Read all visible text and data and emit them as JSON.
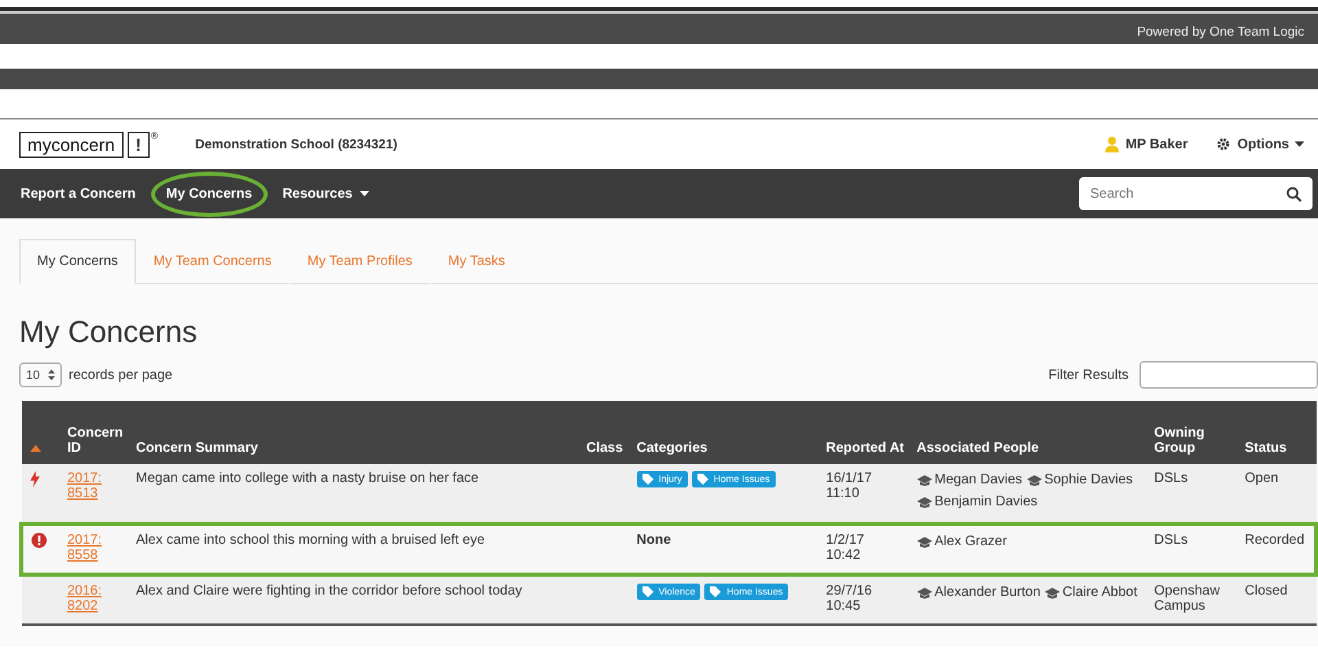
{
  "top_bar": {
    "powered_by": "Powered by One Team Logic"
  },
  "header": {
    "logo": "myconcern",
    "logo_mark": "!",
    "registered": "®",
    "school": "Demonstration School (8234321)",
    "user": "MP Baker",
    "options": "Options"
  },
  "nav": {
    "items": [
      {
        "label": "Report a Concern",
        "dropdown": false,
        "selected": false
      },
      {
        "label": "My Concerns",
        "dropdown": false,
        "selected": true
      },
      {
        "label": "Resources",
        "dropdown": true,
        "selected": false
      }
    ],
    "search": {
      "placeholder": "Search"
    }
  },
  "tabs": [
    {
      "label": "My Concerns",
      "selected": true
    },
    {
      "label": "My Team Concerns",
      "selected": false
    },
    {
      "label": "My Team Profiles",
      "selected": false
    },
    {
      "label": "My Tasks",
      "selected": false
    }
  ],
  "page_title": "My Concerns",
  "records": {
    "value": "10",
    "label": "records per page"
  },
  "filter": {
    "label": "Filter Results"
  },
  "table": {
    "columns": [
      "Concern ID",
      "Concern Summary",
      "Class",
      "Categories",
      "Reported At",
      "Associated People",
      "Owning Group",
      "Status"
    ],
    "rows": [
      {
        "kind": "urgent",
        "highlighted": false,
        "id": [
          "2017:",
          "8513"
        ],
        "summary": "Megan came into college with a nasty bruise on her face",
        "categories": [
          "Injury",
          "Home Issues"
        ],
        "reported": [
          "16/1/17",
          "11:10"
        ],
        "people": [
          "Megan Davies",
          "Sophie Davies",
          "Benjamin Davies"
        ],
        "group": "DSLs",
        "status": "Open"
      },
      {
        "kind": "alert",
        "highlighted": true,
        "id": [
          "2017:",
          "8558"
        ],
        "summary": "Alex came into school this morning with a bruised left eye",
        "no_categories": "None",
        "reported": [
          "1/2/17",
          "10:42"
        ],
        "people": [
          "Alex Grazer"
        ],
        "group": "DSLs",
        "status": "Recorded"
      },
      {
        "kind": "plain",
        "highlighted": false,
        "id": [
          "2016:",
          "8202"
        ],
        "summary": "Alex and Claire were fighting in the corridor before school today",
        "categories": [
          "Violence",
          "Home Issues"
        ],
        "reported": [
          "29/7/16",
          "10:45"
        ],
        "people": [
          "Alexander Burton",
          "Claire Abbot"
        ],
        "group": "Openshaw Campus",
        "status": "Closed"
      }
    ]
  }
}
